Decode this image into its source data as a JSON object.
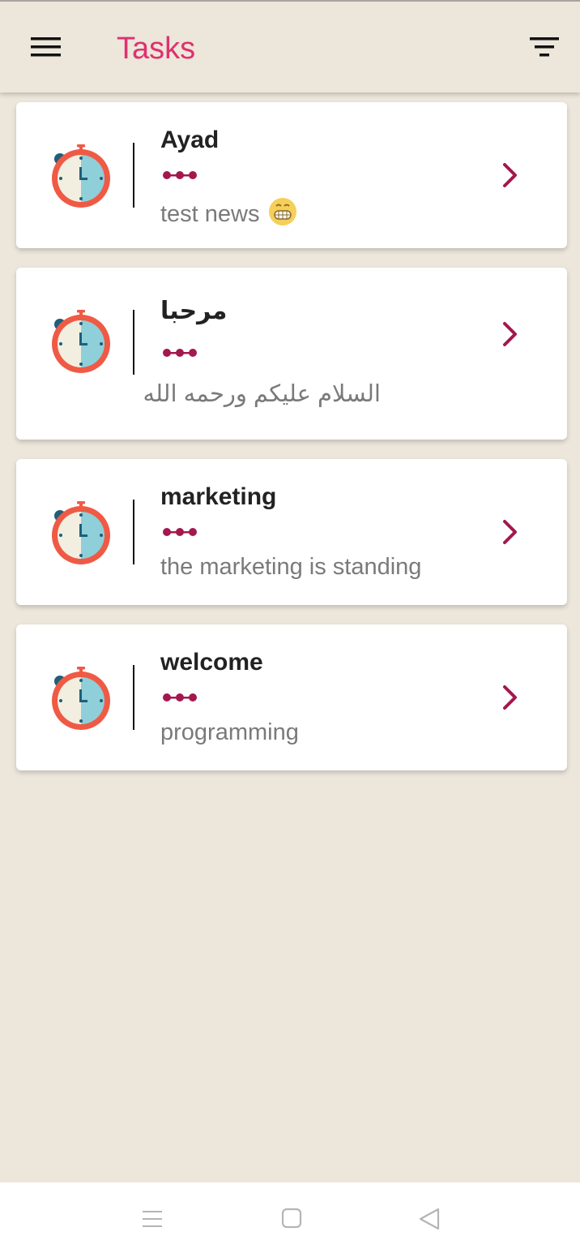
{
  "app": {
    "title": "Tasks"
  },
  "header": {
    "menu_icon": "hamburger-menu-icon",
    "filter_icon": "filter-icon"
  },
  "tasks": [
    {
      "title": "Ayad",
      "subtitle": "test news",
      "emoji": "grinning-face-icon"
    },
    {
      "title": "مرحبا",
      "subtitle": "السلام عليكم ورحمه الله"
    },
    {
      "title": "marketing",
      "subtitle": "the marketing is standing"
    },
    {
      "title": "welcome",
      "subtitle": "programming"
    }
  ],
  "icons": {
    "task": "stopwatch-icon",
    "dots": "dots-icon",
    "open": "chevron-right-icon"
  },
  "colors": {
    "background": "#ece6db",
    "title_accent": "#e0306d",
    "dots_accent": "#a3184e",
    "card": "#ffffff"
  },
  "navbar": {
    "icons": [
      "recent-apps-icon",
      "home-icon",
      "back-icon"
    ]
  }
}
